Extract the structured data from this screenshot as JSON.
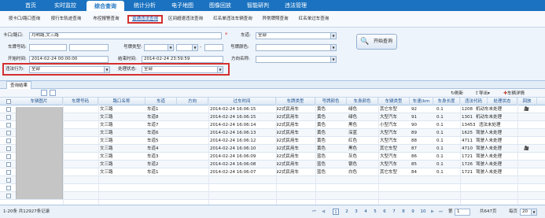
{
  "nav": {
    "items": [
      {
        "label": "首页"
      },
      {
        "label": "实时监控"
      },
      {
        "label": "综合查询"
      },
      {
        "label": "统计分析"
      },
      {
        "label": "电子地图"
      },
      {
        "label": "图像回放"
      },
      {
        "label": "智能研判"
      },
      {
        "label": "违法管理"
      }
    ],
    "active_index": 2
  },
  "subnav": {
    "items": [
      {
        "label": "按卡口/路口查询"
      },
      {
        "label": "按行车轨迹查询"
      },
      {
        "label": "布控报警查询"
      },
      {
        "label": "普通违法查询"
      },
      {
        "label": "区间超速违法查询"
      },
      {
        "label": "红名单违法车辆查询"
      },
      {
        "label": "异常牌照查询"
      },
      {
        "label": "红名单过车查询"
      }
    ],
    "active_index": 3
  },
  "form": {
    "checkpoint_label": "卡口/路口:",
    "checkpoint_value": "月明路,文三路",
    "road_label": "车道:",
    "road_value": "全部",
    "plate_label": "车牌号码:",
    "plate_value": "",
    "plate_type_label": "号牌类型:",
    "plate_type_value": "",
    "plate_color_label": "号牌颜色:",
    "plate_color_value": "",
    "start_label": "开始时间:",
    "start_value": "2014-02-24 00:00:00",
    "end_label": "结束时间:",
    "end_value": "2014-02-24 23:59:59",
    "direction_label": "方向名称:",
    "direction_value": "",
    "violation_label": "违法行为:",
    "violation_value": "全部",
    "status_label": "处理状态:",
    "status_value": "全部",
    "query_button": "开始查询"
  },
  "results": {
    "tab_label": "查询结果"
  },
  "toolbar": {
    "refresh": "刷新",
    "export": "导出",
    "detail": "车辆详情"
  },
  "table": {
    "columns": [
      "车辆图片",
      "车牌号码",
      "路口名称",
      "车道",
      "方向",
      "过车时间",
      "车牌类型",
      "号牌颜色",
      "车身颜色",
      "车辆类型",
      "车速(km",
      "车身长度",
      "违法代码",
      "处理状态",
      "回放"
    ],
    "rows": [
      {
        "road": "文三路",
        "lane": "车道1",
        "time": "2014-02-24 16:06:15",
        "plate_type": "92式民用车",
        "plate_color": "黄色",
        "body_color": "绿色",
        "vehicle_type": "其它车型",
        "speed": "92",
        "length": "0.1",
        "code": "1208",
        "status": "机动车未处理"
      },
      {
        "road": "文三路",
        "lane": "车道8",
        "time": "2014-02-24 16:06:15",
        "plate_type": "92式民用车",
        "plate_color": "黄色",
        "body_color": "绿色",
        "vehicle_type": "大型汽车",
        "speed": "91",
        "length": "0.1",
        "code": "1301",
        "status": "机动车未处理"
      },
      {
        "road": "文三路",
        "lane": "车道7",
        "time": "2014-02-24 16:06:14",
        "plate_type": "92式民用车",
        "plate_color": "黄色",
        "body_color": "黑色",
        "vehicle_type": "小型汽车",
        "speed": "90",
        "length": "0.1",
        "code": "13453",
        "status": "违法未处理"
      },
      {
        "road": "文三路",
        "lane": "车道6",
        "time": "2014-02-24 16:06:13",
        "plate_type": "92式民用车",
        "plate_color": "黄色",
        "body_color": "深蓝",
        "vehicle_type": "大型汽车",
        "speed": "89",
        "length": "0.1",
        "code": "1625",
        "status": "驾驶人未处理"
      },
      {
        "road": "文三路",
        "lane": "车道5",
        "time": "2014-02-24 16:06:12",
        "plate_type": "92式民用车",
        "plate_color": "黄色",
        "body_color": "红色",
        "vehicle_type": "大型汽车",
        "speed": "88",
        "length": "0.1",
        "code": "4711",
        "status": "驾驶人未处理"
      },
      {
        "road": "文三路",
        "lane": "车道4",
        "time": "2014-02-24 16:06:10",
        "plate_type": "92式民用车",
        "plate_color": "黄色",
        "body_color": "黑色",
        "vehicle_type": "其它车型",
        "speed": "87",
        "length": "0.1",
        "code": "4710",
        "status": "驾驶人未处理"
      },
      {
        "road": "文三路",
        "lane": "车道3",
        "time": "2014-02-24 16:06:09",
        "plate_type": "92式民用车",
        "plate_color": "蓝色",
        "body_color": "灰色",
        "vehicle_type": "大型汽车",
        "speed": "86",
        "length": "0.1",
        "code": "1721",
        "status": "驾驶人未处理"
      },
      {
        "road": "文三路",
        "lane": "车道2",
        "time": "2014-02-24 16:06:08",
        "plate_type": "92式民用车",
        "plate_color": "蓝色",
        "body_color": "银色",
        "vehicle_type": "大型汽车",
        "speed": "85",
        "length": "0.1",
        "code": "1726",
        "status": "驾驶人未处理"
      },
      {
        "road": "文三路",
        "lane": "车道1",
        "time": "2014-02-24 16:06:07",
        "plate_type": "92式民用车",
        "plate_color": "蓝色",
        "body_color": "白色",
        "vehicle_type": "其它车型",
        "speed": "84",
        "length": "0.1",
        "code": "1721",
        "status": "驾驶人未处理"
      }
    ]
  },
  "footer": {
    "summary": "1-20条 共12927条记录",
    "pages": [
      "1",
      "2",
      "3",
      "4",
      "5",
      "6",
      "7",
      "8",
      "9",
      "10"
    ],
    "goto_label": "第",
    "goto_value": "1",
    "total_pages": "共647页",
    "per_page_label": "每页",
    "per_page_value": "20"
  },
  "colors": {
    "nav_bg": "#1a72c0",
    "highlight": "#d43030",
    "header_text": "#1a4f8f"
  }
}
